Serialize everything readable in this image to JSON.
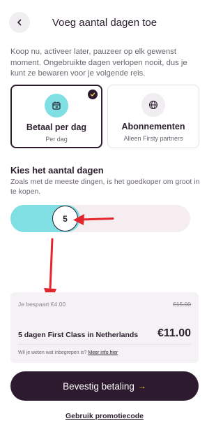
{
  "header": {
    "title": "Voeg aantal dagen toe",
    "back_icon": "chevron-left-icon"
  },
  "intro_text": "Koop nu, activeer later, pauzeer op elk gewenst moment. Ongebruikte dagen verlopen nooit, dus je kunt ze bewaren voor je volgende reis.",
  "plans": [
    {
      "title": "Betaal per dag",
      "subtitle": "Per dag",
      "icon": "calendar-refresh-icon",
      "selected": true
    },
    {
      "title": "Abonnementen",
      "subtitle": "Alleen Firsty partners",
      "icon": "globe-icon",
      "selected": false
    }
  ],
  "days_section": {
    "title": "Kies het aantal dagen",
    "description": "Zoals met de meeste dingen, is het goedkoper om groot in te kopen."
  },
  "slider": {
    "value": "5",
    "fill_fraction": 0.34
  },
  "summary": {
    "saved": "Je bespaart €4.00",
    "old_price": "€15.00",
    "product": "5 dagen First Class in Netherlands",
    "price": "€11.00",
    "info_text": "Wil je weten wat inbegrepen is?",
    "info_link": "Meer info hier"
  },
  "confirm_button": {
    "label": "Bevestig betaling",
    "arrow": "→"
  },
  "promo_link": "Gebruik promotiecode",
  "colors": {
    "accent": "#7fdfe2",
    "dark": "#2e1a2f",
    "annotation": "#e3262d",
    "button_arrow": "#f2d24c"
  }
}
